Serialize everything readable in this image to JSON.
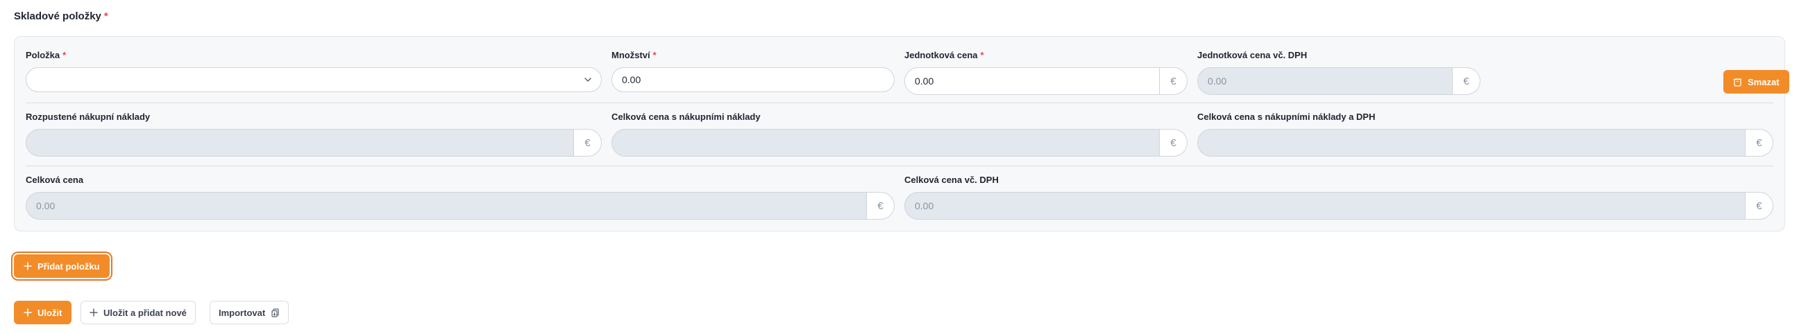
{
  "section": {
    "title": "Skladové položky",
    "required_mark": "*"
  },
  "row1": {
    "item": {
      "label": "Položka",
      "required_mark": "*",
      "value": ""
    },
    "quantity": {
      "label": "Množství",
      "required_mark": "*",
      "value": "0.00"
    },
    "unit_price": {
      "label": "Jednotková cena",
      "required_mark": "*",
      "value": "0.00",
      "currency": "€"
    },
    "unit_price_vat": {
      "label": "Jednotková cena vč. DPH",
      "value": "0.00",
      "currency": "€"
    },
    "delete_label": "Smazat"
  },
  "row2": {
    "purchase_costs": {
      "label": "Rozpustené nákupní náklady",
      "value": "",
      "currency": "€"
    },
    "total_with_costs": {
      "label": "Celková cena s nákupními náklady",
      "value": "",
      "currency": "€"
    },
    "total_with_costs_vat": {
      "label": "Celková cena s nákupními náklady a DPH",
      "value": "",
      "currency": "€"
    }
  },
  "row3": {
    "total": {
      "label": "Celková cena",
      "value": "0.00",
      "currency": "€"
    },
    "total_vat": {
      "label": "Celková cena vč. DPH",
      "value": "0.00",
      "currency": "€"
    }
  },
  "actions": {
    "add_item": "Přidat položku",
    "save": "Uložit",
    "save_and_new": "Uložit a přidat nové",
    "import": "Importovat"
  },
  "colors": {
    "accent": "#f28c28",
    "required": "#e5484d",
    "disabled_bg": "#e3e7ee"
  }
}
